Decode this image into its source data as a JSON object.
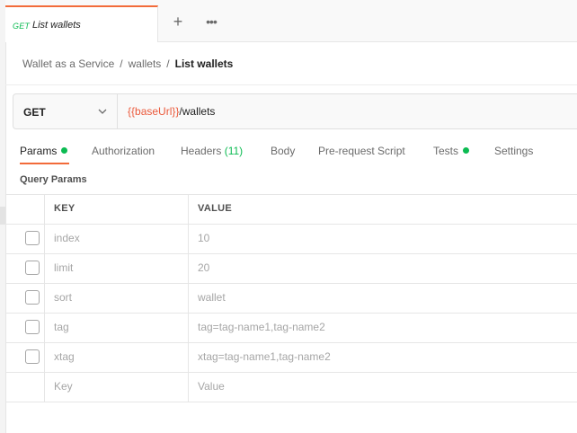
{
  "tab": {
    "method": "GET",
    "title": "List wallets"
  },
  "tabbar": {
    "new_tab_icon": "+",
    "more_icon": "•••"
  },
  "breadcrumb": {
    "items": [
      "Wallet as a Service",
      "wallets"
    ],
    "separator": "/",
    "current": "List wallets"
  },
  "request": {
    "method": "GET",
    "url_variable": "{{baseUrl}}",
    "url_path": "/wallets"
  },
  "request_tabs": [
    {
      "label": "Params",
      "active": true,
      "indicator": true
    },
    {
      "label": "Authorization"
    },
    {
      "label": "Headers",
      "count": "(11)"
    },
    {
      "label": "Body"
    },
    {
      "label": "Pre-request Script"
    },
    {
      "label": "Tests",
      "indicator": true
    },
    {
      "label": "Settings"
    }
  ],
  "query_params": {
    "title": "Query Params",
    "columns": [
      "KEY",
      "VALUE"
    ],
    "rows": [
      {
        "key": "index",
        "value": "10"
      },
      {
        "key": "limit",
        "value": "20"
      },
      {
        "key": "sort",
        "value": "wallet"
      },
      {
        "key": "tag",
        "value": "tag=tag-name1,tag-name2"
      },
      {
        "key": "xtag",
        "value": "xtag=tag-name1,tag-name2"
      }
    ],
    "new_row": {
      "key_placeholder": "Key",
      "value_placeholder": "Value"
    }
  },
  "colors": {
    "accent": "#f26b3a",
    "get_method": "#0cbb52",
    "variable": "#eb5a3c",
    "indicator": "#0cbb52"
  }
}
